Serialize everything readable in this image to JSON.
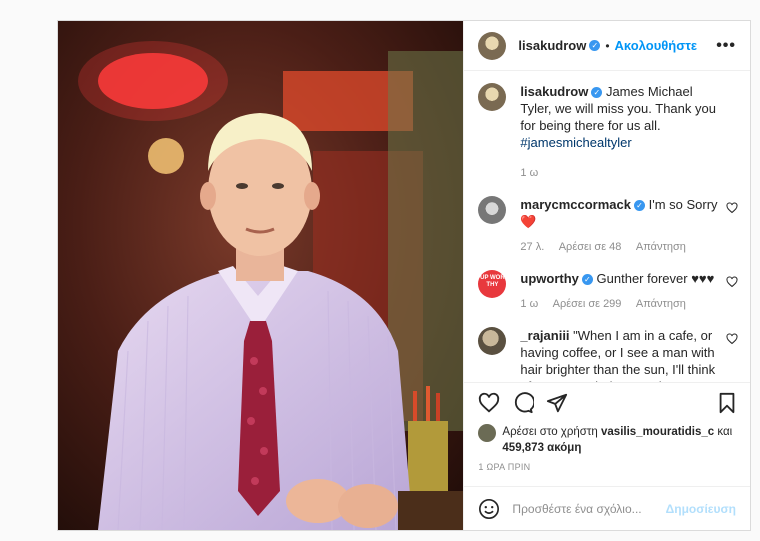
{
  "header": {
    "username": "lisakudrow",
    "separator": "•",
    "follow_label": "Ακολουθήστε",
    "more_label": "•••"
  },
  "caption": {
    "username": "lisakudrow",
    "text": "James Michael Tyler, we will miss you. Thank you for being there for us all.",
    "hashtag": "#jamesmichealtyler",
    "time": "1 ω"
  },
  "comments": [
    {
      "username": "marycmccormack",
      "text": "I'm so Sorry",
      "emoji": "❤️",
      "time": "27 λ.",
      "likes": "Αρέσει σε 48",
      "reply": "Απάντηση"
    },
    {
      "username": "upworthy",
      "text": "Gunther forever ♥♥♥",
      "time": "1 ω",
      "likes": "Αρέσει σε 299",
      "reply": "Απάντηση"
    },
    {
      "username": "_rajaniii",
      "text": "\"When I am in a cafe, or having coffee, or I see a man with hair brighter than the sun, I'll think of you\" - Rachel to Gunther"
    }
  ],
  "likes": {
    "prefix": "Αρέσει στο χρήστη",
    "user": "vasilis_mouratidis_c",
    "and": "και",
    "count": "459,873 ακόμη"
  },
  "timestamp": "1 ΩΡΑ ΠΡΙΝ",
  "add_comment": {
    "placeholder": "Προσθέστε ένα σχόλιο...",
    "post_label": "Δημοσίευση"
  },
  "upworthy_avatar_text": "UP WOR THY",
  "colors": {
    "link_blue": "#0095f6",
    "verified_blue": "#3897f0",
    "heart_red": "#ed4956",
    "upworthy_red": "#e8383d"
  }
}
